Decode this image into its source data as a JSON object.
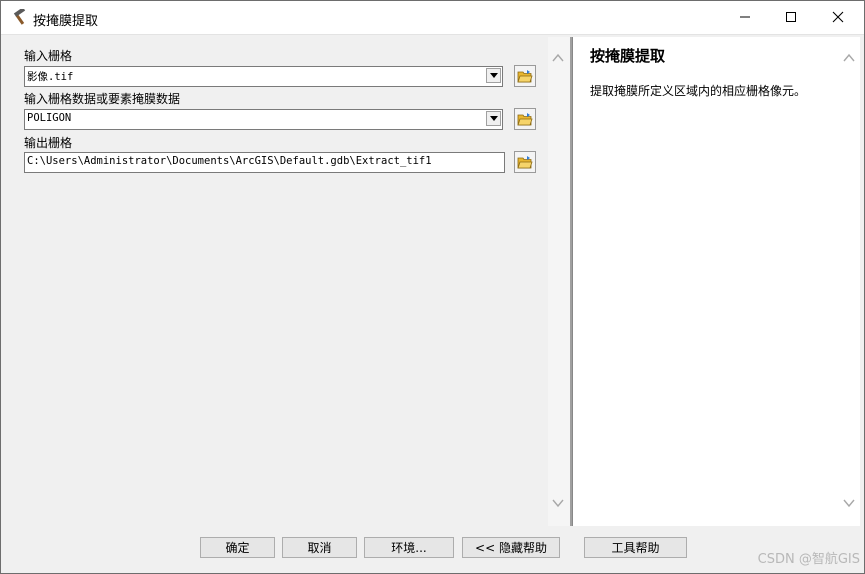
{
  "window": {
    "title": "按掩膜提取",
    "app_icon": "hammer-icon",
    "controls": [
      "minimize-icon",
      "maximize-icon",
      "close-icon"
    ]
  },
  "params": [
    {
      "label": "输入栅格",
      "value": "影像.tif",
      "kind": "combo"
    },
    {
      "label": "输入栅格数据或要素掩膜数据",
      "value": "POLIGON",
      "kind": "combo"
    },
    {
      "label": "输出栅格",
      "value": "C:\\Users\\Administrator\\Documents\\ArcGIS\\Default.gdb\\Extract_tif1",
      "kind": "text"
    }
  ],
  "help": {
    "title": "按掩膜提取",
    "body": "提取掩膜所定义区域内的相应栅格像元。"
  },
  "buttons": {
    "ok": "确定",
    "cancel": "取消",
    "environments": "环境...",
    "hide_help": "<< 隐藏帮助",
    "tool_help": "工具帮助"
  },
  "watermark": "CSDN @智航GIS",
  "colors": {
    "folder": "#e8b62f",
    "accent": "#2d7bd6"
  }
}
